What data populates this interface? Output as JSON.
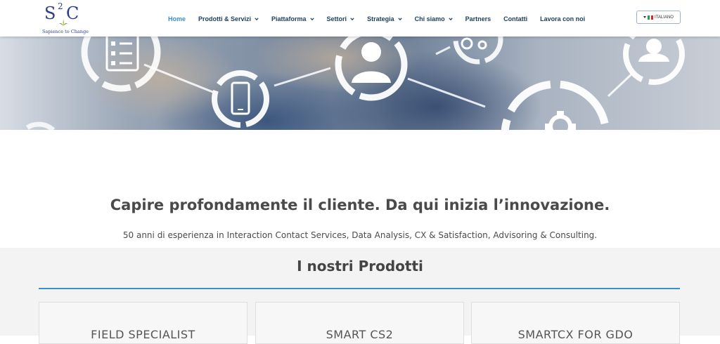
{
  "header": {
    "logo_text": "S2C",
    "logo_tagline": "Sapience to Change",
    "nav": [
      {
        "label": "Home",
        "active": true,
        "dropdown": false
      },
      {
        "label": "Prodotti & Servizi",
        "active": false,
        "dropdown": true
      },
      {
        "label": "Piattaforma",
        "active": false,
        "dropdown": true
      },
      {
        "label": "Settori",
        "active": false,
        "dropdown": true
      },
      {
        "label": "Strategia",
        "active": false,
        "dropdown": true
      },
      {
        "label": "Chi siamo",
        "active": false,
        "dropdown": true
      },
      {
        "label": "Partners",
        "active": false,
        "dropdown": false
      },
      {
        "label": "Contatti",
        "active": false,
        "dropdown": false
      },
      {
        "label": "Lavora con noi",
        "active": false,
        "dropdown": false
      }
    ],
    "language": {
      "label": "ITALIANO",
      "flag_colors": [
        "#2a9d4b",
        "#ffffff",
        "#d62b2b"
      ]
    }
  },
  "hero": {
    "icons": [
      "checklist-icon",
      "smartphone-icon",
      "user-icon",
      "gears-icon",
      "user-icon",
      "gear-icon"
    ]
  },
  "main": {
    "headline": "Capire profondamente il cliente. Da qui inizia l’innovazione.",
    "subline": "50 anni di esperienza in Interaction Contact Services, Data Analysis, CX & Satisfaction, Advisoring & Consulting."
  },
  "products": {
    "title": "I nostri Prodotti",
    "cards": [
      {
        "title": "FIELD SPECIALIST"
      },
      {
        "title": "SMART CS2"
      },
      {
        "title": "SMARTCX FOR GDO"
      }
    ]
  },
  "colors": {
    "accent": "#3a8fcf",
    "nav_text": "#1f3f63",
    "brand": "#2b3f8e"
  }
}
